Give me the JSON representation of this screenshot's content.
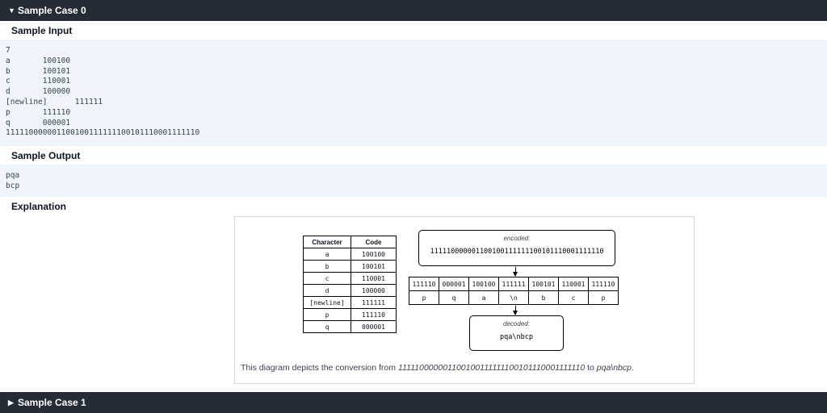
{
  "case0": {
    "header": "Sample Case 0",
    "input_title": "Sample Input",
    "input_lines": [
      "7",
      "a       100100",
      "b       100101",
      "c       110001",
      "d       100000",
      "[newline]      111111",
      "p       111110",
      "q       000001",
      "111110000001100100111111100101110001111110"
    ],
    "output_title": "Sample Output",
    "output_lines": [
      "pqa",
      "bcp"
    ],
    "explanation_title": "Explanation",
    "diagram": {
      "table_headers": [
        "Character",
        "Code"
      ],
      "rows": [
        [
          "a",
          "100100"
        ],
        [
          "b",
          "100101"
        ],
        [
          "c",
          "110001"
        ],
        [
          "d",
          "100000"
        ],
        [
          "[newline]",
          "111111"
        ],
        [
          "p",
          "111110"
        ],
        [
          "q",
          "000001"
        ]
      ],
      "encoded_label": "encoded:",
      "encoded_value": "111110000001100100111111100101110001111110",
      "segments_codes": [
        "111110",
        "000001",
        "100100",
        "111111",
        "100101",
        "110001",
        "111110"
      ],
      "segments_chars": [
        "p",
        "q",
        "a",
        "\\n",
        "b",
        "c",
        "p"
      ],
      "decoded_label": "decoded:",
      "decoded_value": "pqa\\nbcp"
    },
    "caption": {
      "prefix": "This diagram depicts the conversion from ",
      "from": "111110000001100100111111100101110001111110",
      "middle": " to ",
      "to": "pqa\\nbcp",
      "suffix": "."
    }
  },
  "case1": {
    "header": "Sample Case 1"
  }
}
